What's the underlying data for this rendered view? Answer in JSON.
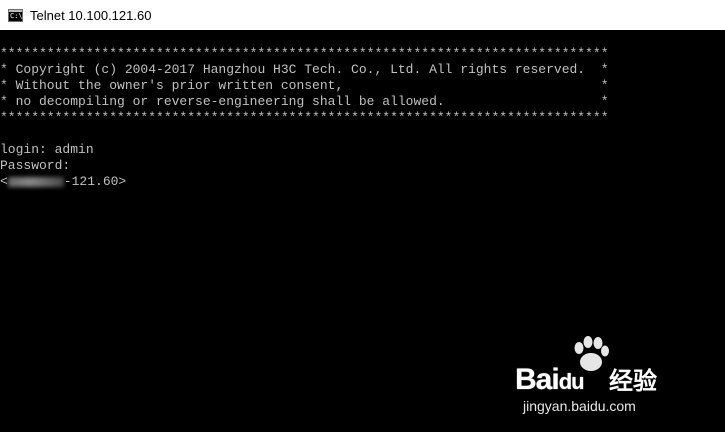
{
  "window": {
    "title": "Telnet 10.100.121.60",
    "icon": "console-app-icon"
  },
  "console": {
    "lines": [
      "******************************************************************************",
      "* Copyright (c) 2004-2017 Hangzhou H3C Tech. Co., Ltd. All rights reserved.  *",
      "* Without the owner's prior written consent,                                 *",
      "* no decompiling or reverse-engineering shall be allowed.                    *",
      "******************************************************************************",
      "",
      "login: admin",
      "Password:"
    ],
    "prompt_open": "<",
    "prompt_visible": "-121.60>"
  },
  "watermark": {
    "brand": "Bai",
    "brand_suffix": "du",
    "chinese": "经验",
    "url": "jingyan.baidu.com"
  },
  "colors": {
    "titlebar_bg": "#ffffff",
    "console_bg": "#000000",
    "console_text": "#c0c0c0"
  }
}
